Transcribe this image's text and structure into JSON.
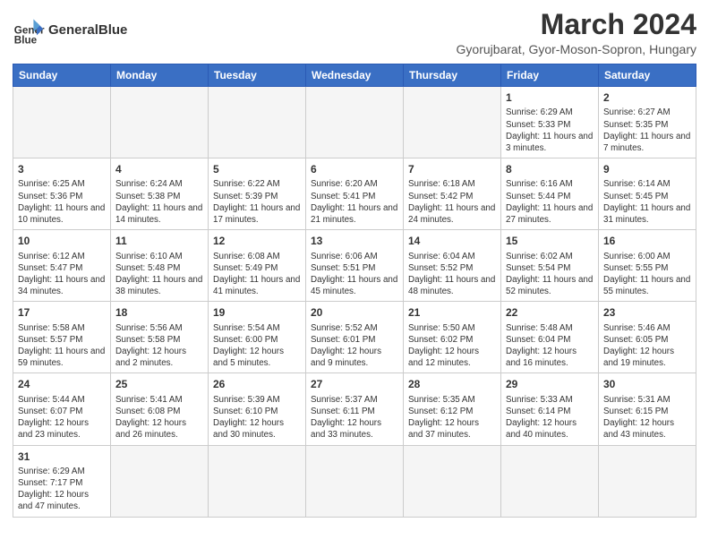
{
  "header": {
    "logo_text_normal": "General",
    "logo_text_bold": "Blue",
    "month_year": "March 2024",
    "location": "Gyorujbarat, Gyor-Moson-Sopron, Hungary"
  },
  "days_of_week": [
    "Sunday",
    "Monday",
    "Tuesday",
    "Wednesday",
    "Thursday",
    "Friday",
    "Saturday"
  ],
  "weeks": [
    [
      {
        "day": "",
        "info": ""
      },
      {
        "day": "",
        "info": ""
      },
      {
        "day": "",
        "info": ""
      },
      {
        "day": "",
        "info": ""
      },
      {
        "day": "",
        "info": ""
      },
      {
        "day": "1",
        "info": "Sunrise: 6:29 AM\nSunset: 5:33 PM\nDaylight: 11 hours\nand 3 minutes."
      },
      {
        "day": "2",
        "info": "Sunrise: 6:27 AM\nSunset: 5:35 PM\nDaylight: 11 hours\nand 7 minutes."
      }
    ],
    [
      {
        "day": "3",
        "info": "Sunrise: 6:25 AM\nSunset: 5:36 PM\nDaylight: 11 hours\nand 10 minutes."
      },
      {
        "day": "4",
        "info": "Sunrise: 6:24 AM\nSunset: 5:38 PM\nDaylight: 11 hours\nand 14 minutes."
      },
      {
        "day": "5",
        "info": "Sunrise: 6:22 AM\nSunset: 5:39 PM\nDaylight: 11 hours\nand 17 minutes."
      },
      {
        "day": "6",
        "info": "Sunrise: 6:20 AM\nSunset: 5:41 PM\nDaylight: 11 hours\nand 21 minutes."
      },
      {
        "day": "7",
        "info": "Sunrise: 6:18 AM\nSunset: 5:42 PM\nDaylight: 11 hours\nand 24 minutes."
      },
      {
        "day": "8",
        "info": "Sunrise: 6:16 AM\nSunset: 5:44 PM\nDaylight: 11 hours\nand 27 minutes."
      },
      {
        "day": "9",
        "info": "Sunrise: 6:14 AM\nSunset: 5:45 PM\nDaylight: 11 hours\nand 31 minutes."
      }
    ],
    [
      {
        "day": "10",
        "info": "Sunrise: 6:12 AM\nSunset: 5:47 PM\nDaylight: 11 hours\nand 34 minutes."
      },
      {
        "day": "11",
        "info": "Sunrise: 6:10 AM\nSunset: 5:48 PM\nDaylight: 11 hours\nand 38 minutes."
      },
      {
        "day": "12",
        "info": "Sunrise: 6:08 AM\nSunset: 5:49 PM\nDaylight: 11 hours\nand 41 minutes."
      },
      {
        "day": "13",
        "info": "Sunrise: 6:06 AM\nSunset: 5:51 PM\nDaylight: 11 hours\nand 45 minutes."
      },
      {
        "day": "14",
        "info": "Sunrise: 6:04 AM\nSunset: 5:52 PM\nDaylight: 11 hours\nand 48 minutes."
      },
      {
        "day": "15",
        "info": "Sunrise: 6:02 AM\nSunset: 5:54 PM\nDaylight: 11 hours\nand 52 minutes."
      },
      {
        "day": "16",
        "info": "Sunrise: 6:00 AM\nSunset: 5:55 PM\nDaylight: 11 hours\nand 55 minutes."
      }
    ],
    [
      {
        "day": "17",
        "info": "Sunrise: 5:58 AM\nSunset: 5:57 PM\nDaylight: 11 hours\nand 59 minutes."
      },
      {
        "day": "18",
        "info": "Sunrise: 5:56 AM\nSunset: 5:58 PM\nDaylight: 12 hours\nand 2 minutes."
      },
      {
        "day": "19",
        "info": "Sunrise: 5:54 AM\nSunset: 6:00 PM\nDaylight: 12 hours\nand 5 minutes."
      },
      {
        "day": "20",
        "info": "Sunrise: 5:52 AM\nSunset: 6:01 PM\nDaylight: 12 hours\nand 9 minutes."
      },
      {
        "day": "21",
        "info": "Sunrise: 5:50 AM\nSunset: 6:02 PM\nDaylight: 12 hours\nand 12 minutes."
      },
      {
        "day": "22",
        "info": "Sunrise: 5:48 AM\nSunset: 6:04 PM\nDaylight: 12 hours\nand 16 minutes."
      },
      {
        "day": "23",
        "info": "Sunrise: 5:46 AM\nSunset: 6:05 PM\nDaylight: 12 hours\nand 19 minutes."
      }
    ],
    [
      {
        "day": "24",
        "info": "Sunrise: 5:44 AM\nSunset: 6:07 PM\nDaylight: 12 hours\nand 23 minutes."
      },
      {
        "day": "25",
        "info": "Sunrise: 5:41 AM\nSunset: 6:08 PM\nDaylight: 12 hours\nand 26 minutes."
      },
      {
        "day": "26",
        "info": "Sunrise: 5:39 AM\nSunset: 6:10 PM\nDaylight: 12 hours\nand 30 minutes."
      },
      {
        "day": "27",
        "info": "Sunrise: 5:37 AM\nSunset: 6:11 PM\nDaylight: 12 hours\nand 33 minutes."
      },
      {
        "day": "28",
        "info": "Sunrise: 5:35 AM\nSunset: 6:12 PM\nDaylight: 12 hours\nand 37 minutes."
      },
      {
        "day": "29",
        "info": "Sunrise: 5:33 AM\nSunset: 6:14 PM\nDaylight: 12 hours\nand 40 minutes."
      },
      {
        "day": "30",
        "info": "Sunrise: 5:31 AM\nSunset: 6:15 PM\nDaylight: 12 hours\nand 43 minutes."
      }
    ],
    [
      {
        "day": "31",
        "info": "Sunrise: 6:29 AM\nSunset: 7:17 PM\nDaylight: 12 hours\nand 47 minutes."
      },
      {
        "day": "",
        "info": ""
      },
      {
        "day": "",
        "info": ""
      },
      {
        "day": "",
        "info": ""
      },
      {
        "day": "",
        "info": ""
      },
      {
        "day": "",
        "info": ""
      },
      {
        "day": "",
        "info": ""
      }
    ]
  ]
}
